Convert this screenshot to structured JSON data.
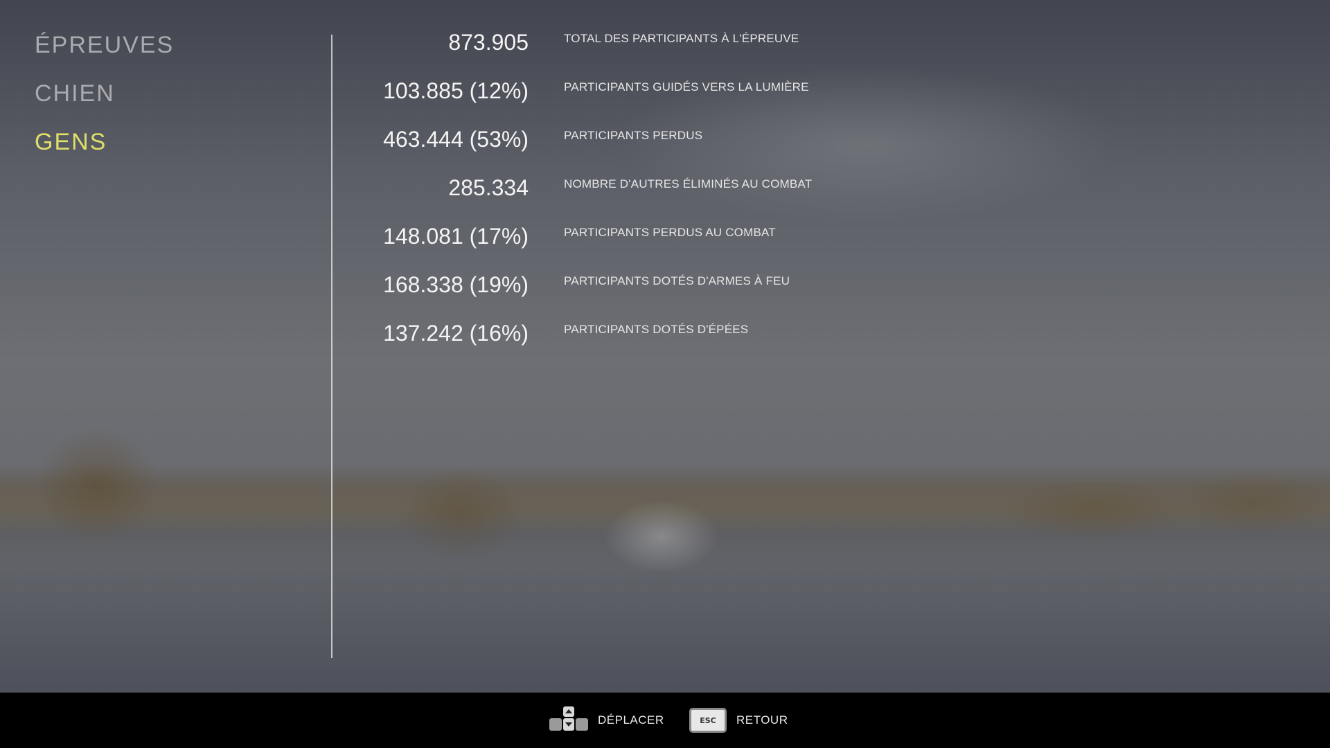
{
  "menu": {
    "items": [
      {
        "label": "ÉPREUVES",
        "active": false
      },
      {
        "label": "CHIEN",
        "active": false
      },
      {
        "label": "GENS",
        "active": true
      }
    ],
    "active_color": "#e0df6a",
    "inactive_color": "#a9abaf"
  },
  "stats": [
    {
      "value": "873.905",
      "label": "TOTAL DES PARTICIPANTS À L'ÉPREUVE"
    },
    {
      "value": "103.885 (12%)",
      "label": "PARTICIPANTS GUIDÉS VERS LA LUMIÈRE"
    },
    {
      "value": "463.444 (53%)",
      "label": "PARTICIPANTS PERDUS"
    },
    {
      "value": "285.334",
      "label": "NOMBRE D'AUTRES ÉLIMINÉS AU COMBAT"
    },
    {
      "value": "148.081 (17%)",
      "label": "PARTICIPANTS PERDUS AU COMBAT"
    },
    {
      "value": "168.338 (19%)",
      "label": "PARTICIPANTS DOTÉS D'ARMES À FEU"
    },
    {
      "value": "137.242 (16%)",
      "label": "PARTICIPANTS DOTÉS D'ÉPÉES"
    }
  ],
  "bottom_bar": {
    "move": {
      "icon": "dpad-icon",
      "label": "DÉPLACER"
    },
    "back": {
      "icon": "esc-key-icon",
      "key": "ESC",
      "label": "RETOUR"
    }
  }
}
